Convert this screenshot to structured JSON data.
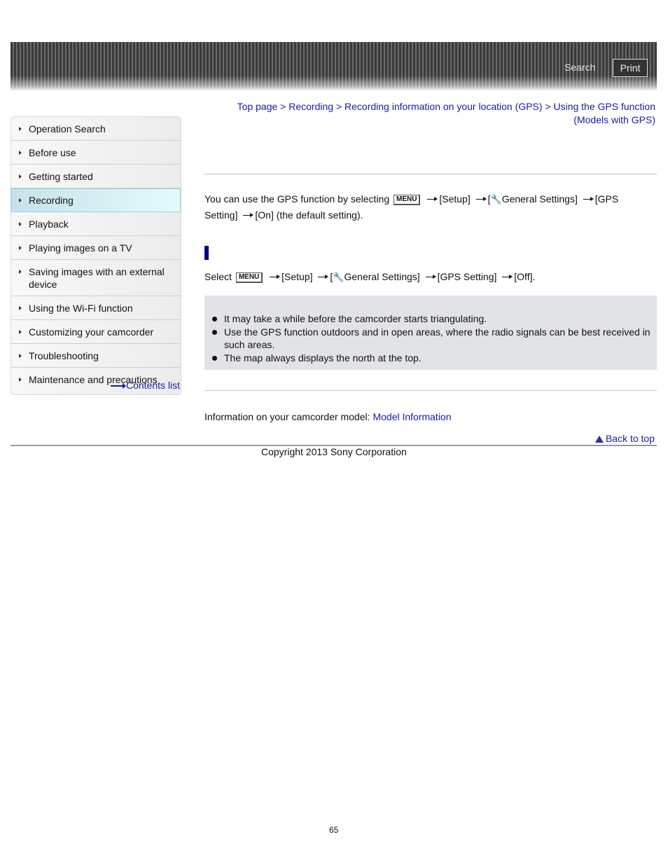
{
  "header": {
    "search_label": "Search",
    "print_label": "Print"
  },
  "breadcrumb": {
    "items": [
      "Top page",
      "Recording",
      "Recording information on your location (GPS)",
      "Using the GPS function (Models with GPS)"
    ],
    "separator": ">"
  },
  "sidebar": {
    "items": [
      {
        "label": "Operation Search"
      },
      {
        "label": "Before use"
      },
      {
        "label": "Getting started"
      },
      {
        "label": "Recording",
        "active": true
      },
      {
        "label": "Playback"
      },
      {
        "label": "Playing images on a TV"
      },
      {
        "label": "Saving images with an external device"
      },
      {
        "label": "Using the Wi-Fi function"
      },
      {
        "label": "Customizing your camcorder"
      },
      {
        "label": "Troubleshooting"
      },
      {
        "label": "Maintenance and precautions"
      }
    ],
    "contents_list_label": "Contents list"
  },
  "main": {
    "intro": {
      "prefix": "You can use the GPS function by selecting",
      "menu_key": "MENU",
      "step1": "[Setup]",
      "step2_open": "[",
      "step2_icon": "wrench-icon",
      "step2_text": "General Settings]",
      "step3": "[GPS Setting]",
      "step4": "[On] (the default setting)."
    },
    "cancel": {
      "prefix": "Select",
      "menu_key": "MENU",
      "step1": "[Setup]",
      "step2_open": "[",
      "step2_text": "General Settings]",
      "step3": "[GPS Setting]",
      "step4": "[Off]."
    },
    "notes": [
      "It may take a while before the camcorder starts triangulating.",
      "Use the GPS function outdoors and in open areas, where the radio signals can be best received in such areas.",
      "The map always displays the north at the top."
    ],
    "model_info_prefix": "Information on your camcorder model:",
    "model_info_link": "Model Information",
    "back_to_top": "Back to top"
  },
  "footer": {
    "copyright": "Copyright 2013 Sony Corporation",
    "page_number": "65"
  },
  "colors": {
    "link": "#1a1aa6",
    "heading_bar": "#00008b",
    "note_bg": "#e1e3e7",
    "active_nav": "#d4eef4"
  }
}
